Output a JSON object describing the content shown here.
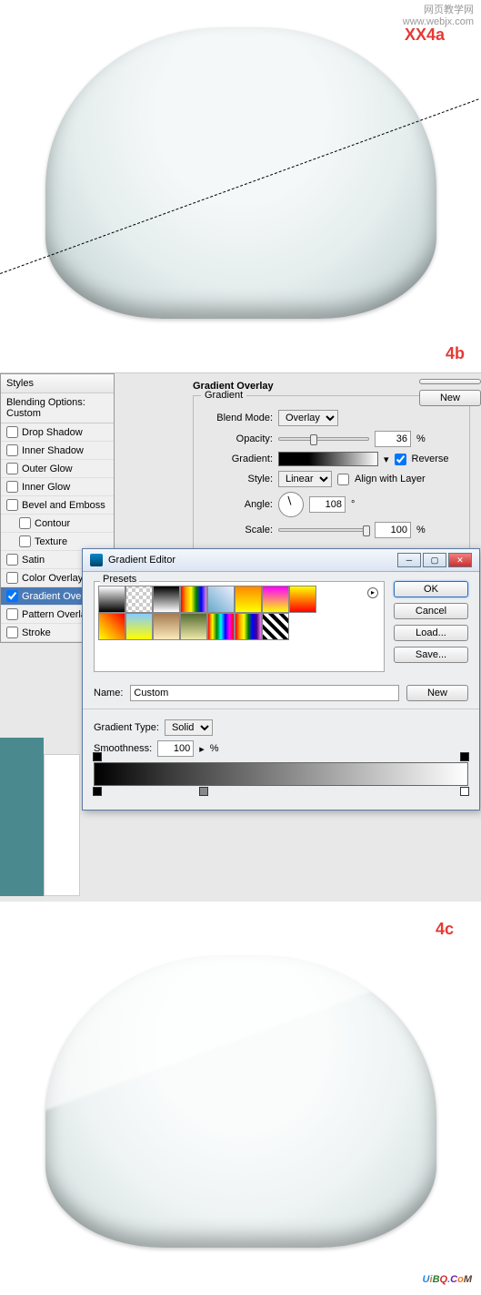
{
  "watermark": {
    "line1": "网页教学网",
    "line2": "www.webjx.com"
  },
  "labels": {
    "a": "XX4a",
    "b": "4b",
    "c": "4c"
  },
  "styles_panel": {
    "header": "Styles",
    "blending": "Blending Options: Custom",
    "items": [
      {
        "label": "Drop Shadow",
        "checked": false,
        "indent": false
      },
      {
        "label": "Inner Shadow",
        "checked": false,
        "indent": false
      },
      {
        "label": "Outer Glow",
        "checked": false,
        "indent": false
      },
      {
        "label": "Inner Glow",
        "checked": false,
        "indent": false
      },
      {
        "label": "Bevel and Emboss",
        "checked": false,
        "indent": false
      },
      {
        "label": "Contour",
        "checked": false,
        "indent": true
      },
      {
        "label": "Texture",
        "checked": false,
        "indent": true
      },
      {
        "label": "Satin",
        "checked": false,
        "indent": false
      },
      {
        "label": "Color Overlay",
        "checked": false,
        "indent": false
      },
      {
        "label": "Gradient Overlay",
        "checked": true,
        "indent": false,
        "active": true,
        "display": "Gradient Ove"
      },
      {
        "label": "Pattern Overlay",
        "checked": false,
        "indent": false
      },
      {
        "label": "Stroke",
        "checked": false,
        "indent": false
      }
    ]
  },
  "gradient_overlay": {
    "title": "Gradient Overlay",
    "group": "Gradient",
    "blend_mode_label": "Blend Mode:",
    "blend_mode": "Overlay",
    "opacity_label": "Opacity:",
    "opacity": "36",
    "opacity_unit": "%",
    "gradient_label": "Gradient:",
    "reverse_label": "Reverse",
    "reverse": true,
    "style_label": "Style:",
    "style": "Linear",
    "align_label": "Align with Layer",
    "align": false,
    "angle_label": "Angle:",
    "angle": "108",
    "angle_unit": "°",
    "scale_label": "Scale:",
    "scale": "100",
    "scale_unit": "%",
    "new_btn": "New"
  },
  "gradient_editor": {
    "title": "Gradient Editor",
    "presets_label": "Presets",
    "buttons": {
      "ok": "OK",
      "cancel": "Cancel",
      "load": "Load...",
      "save": "Save..."
    },
    "name_label": "Name:",
    "name_value": "Custom",
    "new_btn": "New",
    "type_label": "Gradient Type:",
    "type_value": "Solid",
    "smoothness_label": "Smoothness:",
    "smoothness_value": "100",
    "smoothness_unit": "%",
    "swatches": [
      "linear-gradient(#fff,#000)",
      "repeating-conic-gradient(#ccc 0 25%,#fff 0 50%) 50%/8px 8px",
      "linear-gradient(#000,#fff)",
      "linear-gradient(to right,red,orange,yellow,green,blue,violet)",
      "linear-gradient(45deg,#6ac,#eef)",
      "linear-gradient(#f80,#ff0)",
      "linear-gradient(#f0f,#ff0)",
      "linear-gradient(#ff0,#f00)",
      "linear-gradient(45deg,#ff0,#f80,#f00)",
      "linear-gradient(#8cf,#ff0)",
      "linear-gradient(#a67c52,#fceabb)",
      "linear-gradient(#556b2f,#eee8aa)",
      "linear-gradient(to right,red,yellow,green,cyan,blue,magenta,red)",
      "linear-gradient(to right,red,orange,yellow,green,blue,indigo,violet)",
      "repeating-linear-gradient(45deg,#000 0 4px,#fff 4px 8px)"
    ]
  },
  "footer": {
    "u": "U",
    "i": "i",
    "b": "B",
    "q": "Q",
    "dot": ".",
    "c": "C",
    "o": "o",
    "m": "M"
  }
}
